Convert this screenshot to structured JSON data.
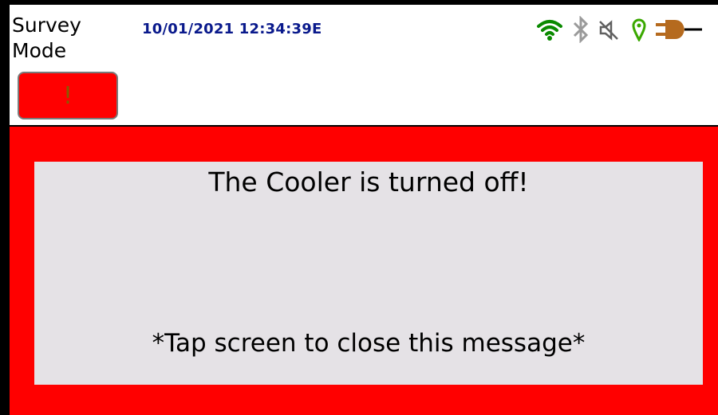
{
  "header": {
    "mode_line1": "Survey",
    "mode_line2": "Mode",
    "datetime": "10/01/2021 12:34:39E",
    "alert_button_label": "!"
  },
  "status_icons": [
    {
      "name": "wifi-icon",
      "color": "#0a8a00"
    },
    {
      "name": "bluetooth-icon",
      "color": "#9a9a9a"
    },
    {
      "name": "speaker-muted-icon",
      "color": "#606060"
    },
    {
      "name": "location-pin-icon",
      "color": "#3aa800"
    },
    {
      "name": "power-plug-icon",
      "color": "#b56a1e"
    }
  ],
  "alert": {
    "title": "The Cooler is turned off!",
    "hint": "*Tap screen to close this message*"
  },
  "colors": {
    "alert_red": "#ff0000",
    "message_bg": "#e5e2e6",
    "datetime_blue": "#0a1a8c"
  }
}
